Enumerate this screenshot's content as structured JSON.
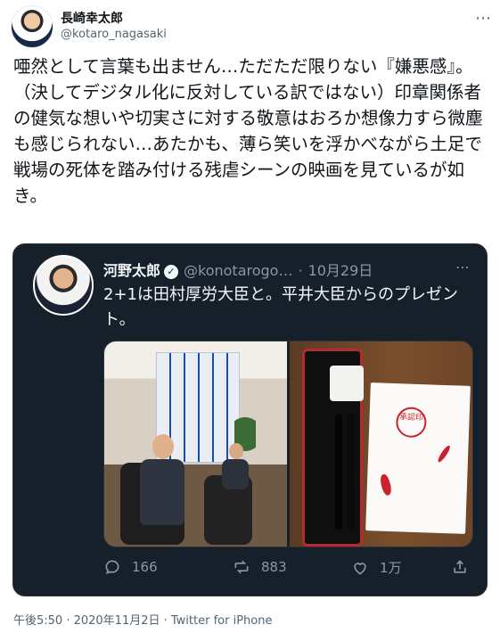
{
  "author": {
    "name": "長崎幸太郎",
    "handle": "@kotaro_nagasaki"
  },
  "tweet": {
    "text": "唖然として言葉も出ません…ただただ限りない『嫌悪感』。\n（決してデジタル化に反対している訳ではない）印章関係者の健気な想いや切実さに対する敬意はおろか想像力すら微塵も感じられない…あたかも、薄ら笑いを浮かべながら土足で戦場の死体を踏み付ける残虐シーンの映画を見ているが如き。"
  },
  "quoted": {
    "name": "河野太郎",
    "handle": "@konotarogo…",
    "separator": "·",
    "date": "10月29日",
    "text": "2+1は田村厚労大臣と。平井大臣からのプレゼント。",
    "seal_text": "承認印",
    "stats": {
      "replies": "166",
      "retweets": "883",
      "likes": "1万"
    }
  },
  "footer": {
    "meta": "午後5:50 · 2020年11月2日 · Twitter for iPhone"
  },
  "icons": {
    "more": "more-horizontal-icon",
    "verified": "verified-badge-icon",
    "reply": "reply-icon",
    "retweet": "retweet-icon",
    "like": "heart-icon",
    "share": "share-icon"
  },
  "colors": {
    "quote_background": "#15202b",
    "secondary_text": "#536471",
    "stamp_red": "#c8232b"
  }
}
